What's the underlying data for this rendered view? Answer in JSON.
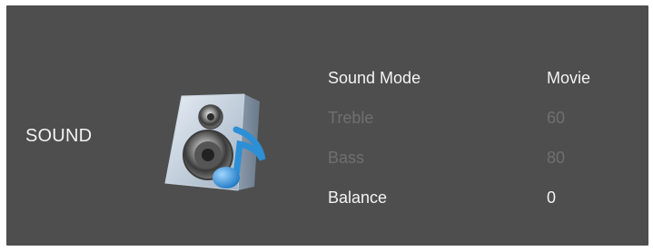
{
  "page": {
    "title": "SOUND",
    "icon": "speaker-music-note-icon"
  },
  "menu": {
    "items": [
      {
        "label": "Sound Mode",
        "value": "Movie",
        "state": "enabled"
      },
      {
        "label": "Treble",
        "value": "60",
        "state": "disabled"
      },
      {
        "label": "Bass",
        "value": "80",
        "state": "disabled"
      },
      {
        "label": "Balance",
        "value": "0",
        "state": "enabled"
      }
    ]
  },
  "colors": {
    "background": "#4e4e4e",
    "text_enabled": "#f3f3f3",
    "text_disabled": "#6f6f6f",
    "note_blue": "#2d8fd6"
  }
}
